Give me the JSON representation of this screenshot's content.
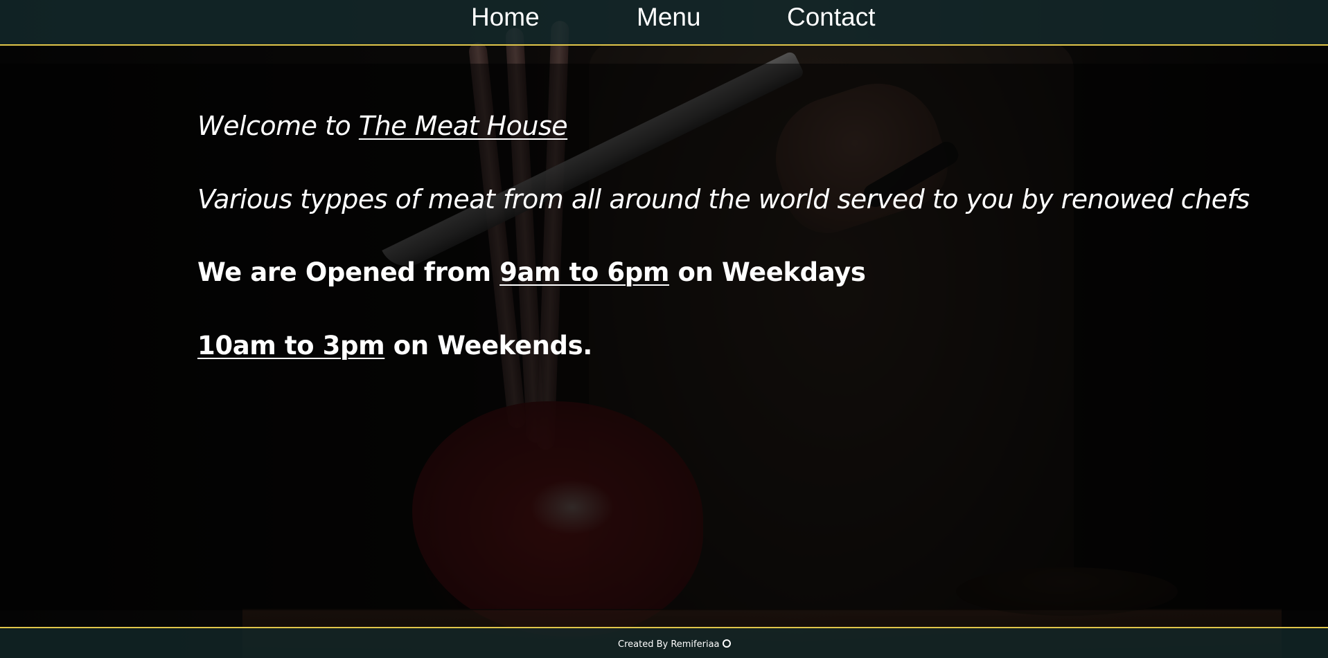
{
  "nav": {
    "home": "Home",
    "menu": "Menu",
    "contact": "Contact"
  },
  "welcome": {
    "prefix": "Welcome to ",
    "name": "The Meat House"
  },
  "tagline": "Various typpes of meat from all around the world served to you by renowed chefs",
  "hours": {
    "weekday_prefix": "We are Opened from ",
    "weekday_time": "9am to 6pm",
    "weekday_suffix": " on Weekdays",
    "weekend_time": "10am to 3pm",
    "weekend_suffix": " on Weekends."
  },
  "footer": {
    "credit": "Created By Remiferiaa",
    "icon": "github-icon"
  },
  "colors": {
    "header_bg": "#142c2e",
    "accent_border": "#e1c64a",
    "text": "#ffffff"
  }
}
